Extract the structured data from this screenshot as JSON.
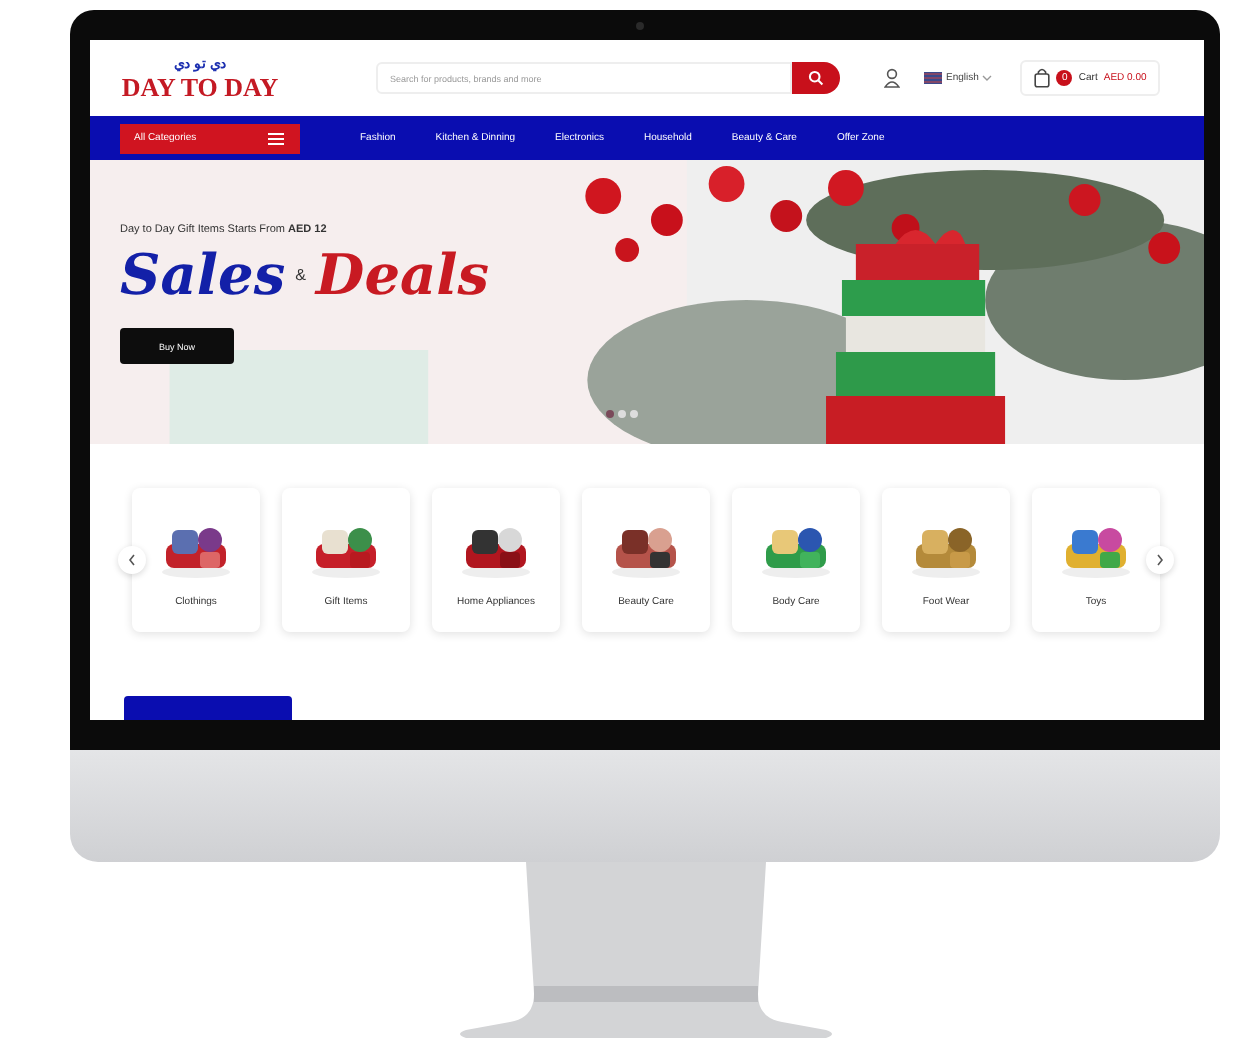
{
  "logo": {
    "arabic": "دي تو دي",
    "text": "DAY TO DAY"
  },
  "search": {
    "placeholder": "Search for products, brands and more"
  },
  "language": "English",
  "cart": {
    "count": "0",
    "label": "Cart",
    "total": "AED 0.00"
  },
  "nav": {
    "categories_button": "All Categories",
    "links": [
      "Fashion",
      "Kitchen & Dinning",
      "Electronics",
      "Household",
      "Beauty & Care",
      "Offer Zone"
    ]
  },
  "banner": {
    "subtitle": "Day to Day Gift Items Starts From **AED 12**",
    "title_1": "Sales",
    "amp": "&",
    "title_2": "Deals",
    "button": "Buy Now",
    "slides": [
      {
        "selected": true
      },
      {
        "selected": false
      },
      {
        "selected": false
      }
    ]
  },
  "categories": [
    {
      "label": "Clothings"
    },
    {
      "label": "Gift Items"
    },
    {
      "label": "Home Appliances"
    },
    {
      "label": "Beauty Care"
    },
    {
      "label": "Body Care"
    },
    {
      "label": "Foot Wear"
    },
    {
      "label": "Toys"
    }
  ]
}
